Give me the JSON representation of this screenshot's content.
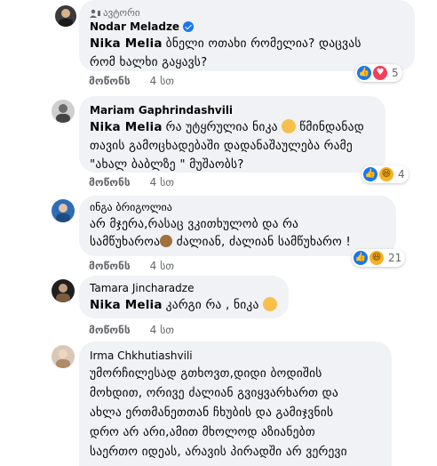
{
  "comments": [
    {
      "badge": "ავტორი",
      "author": "Nodar Meladze",
      "verified": true,
      "tag": "Nika Melia",
      "lines": [
        "ბნელი ოთახი რომელია? დაცვას",
        "რომ ხალხი გაყავს?"
      ],
      "actions": {
        "like": "მოწონს",
        "time": "4 სთ"
      },
      "reaction_count": "5"
    },
    {
      "author": "Mariam Gaphrindashvili",
      "tag": "Nika Melia",
      "lines": [
        "რა უტყრულია ნიკა",
        "თავის გამოცხადებაში დადანაშაულება რამე",
        "\"ახალ ბაბლზე \" მუშაობს?"
      ],
      "line1_tail": "წმინდანად",
      "actions": {
        "like": "მოწონს",
        "time": "4 სთ"
      },
      "reaction_count": "4"
    },
    {
      "author": "ინგა ბრიგოლია",
      "lines": [
        "არ მჯერა,რასაც ვკითხულობ და რა",
        "სამწუხაროა",
        "ძალიან, ძალიან სამწუხარო !"
      ],
      "actions": {
        "like": "მოწონს",
        "time": "4 სთ"
      },
      "reaction_count": "21"
    },
    {
      "author": "Tamara Jincharadze",
      "tag": "Nika Melia",
      "lines": [
        "კარგი რა , ნიკა"
      ],
      "actions": {
        "like": "მოწონს",
        "time": "4 სთ"
      }
    },
    {
      "author": "Irma Chkhutiashvili",
      "lines": [
        "უმორჩილესად გთხოვთ,დიდი ბოდიშის",
        "მოხდით, ორივე ძალიან გვიყვარხართ და",
        "ახლა ერთმანეთთან ჩხუბის და გამიჯვნის",
        "დრო არ არი,ამით მხოლოდ აზიანებთ",
        "საერთო იდეას, არავის პირადში არ ვერევი"
      ]
    }
  ],
  "colors": {
    "like": "#1877f2",
    "love": "#f33e58",
    "haha": "#f7b125",
    "bubble": "#f0f2f5"
  },
  "icons": [
    "author-badge-icon",
    "verified-icon",
    "like-reaction-icon",
    "love-reaction-icon",
    "haha-reaction-icon",
    "smile-emoji",
    "monkey-emoji"
  ]
}
